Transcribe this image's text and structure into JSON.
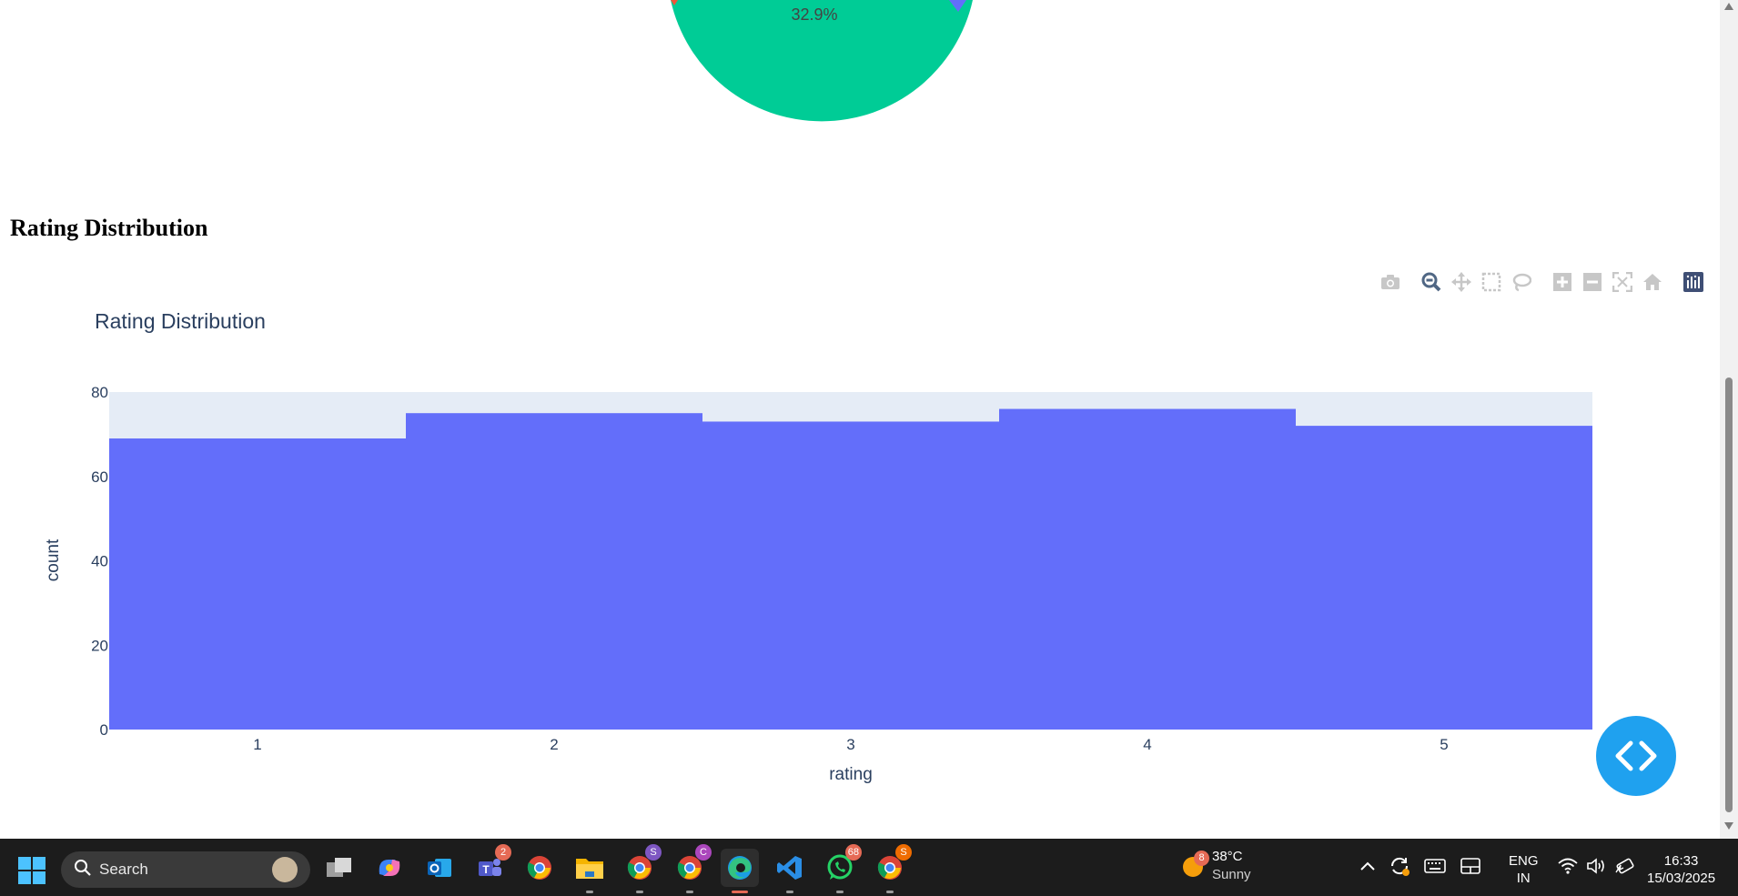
{
  "section_heading": "Rating Distribution",
  "pie_chart": {
    "visible_label": "32.9%",
    "colors": {
      "main": "#00cc96",
      "left": "#ef553b",
      "right": "#636efa"
    }
  },
  "modebar": [
    {
      "name": "download-plot-icon",
      "title": "Download plot as a png"
    },
    {
      "name": "zoom-icon",
      "title": "Zoom"
    },
    {
      "name": "pan-icon",
      "title": "Pan"
    },
    {
      "name": "box-select-icon",
      "title": "Box Select"
    },
    {
      "name": "lasso-select-icon",
      "title": "Lasso Select"
    },
    {
      "name": "zoom-in-icon",
      "title": "Zoom in"
    },
    {
      "name": "zoom-out-icon",
      "title": "Zoom out"
    },
    {
      "name": "autoscale-icon",
      "title": "Autoscale"
    },
    {
      "name": "reset-axes-icon",
      "title": "Reset axes"
    },
    {
      "name": "plotly-logo-icon",
      "title": "Produced with Plotly"
    }
  ],
  "chart_data": {
    "type": "bar",
    "title": "Rating Distribution",
    "xlabel": "rating",
    "ylabel": "count",
    "categories": [
      "1",
      "2",
      "3",
      "4",
      "5"
    ],
    "values": [
      69,
      75,
      73,
      76,
      72
    ],
    "ylim": [
      0,
      80
    ],
    "yticks": [
      "0",
      "20",
      "40",
      "60",
      "80"
    ],
    "bar_color": "#636efa",
    "plot_bg": "#e5ecf6",
    "grid": false,
    "legend": "none"
  },
  "fab": {
    "icon": "code-brackets-icon"
  },
  "taskbar": {
    "search_label": "Search",
    "apps": [
      {
        "name": "task-view-icon",
        "badge": ""
      },
      {
        "name": "copilot-icon",
        "badge": ""
      },
      {
        "name": "outlook-icon",
        "badge": ""
      },
      {
        "name": "teams-icon",
        "badge": "2"
      },
      {
        "name": "chrome-icon",
        "badge": ""
      },
      {
        "name": "file-explorer-icon",
        "badge": ""
      },
      {
        "name": "chrome-profile-s-icon",
        "badge": "S"
      },
      {
        "name": "chrome-profile-c-icon",
        "badge": "C"
      },
      {
        "name": "edge-icon",
        "badge": ""
      },
      {
        "name": "vscode-icon",
        "badge": ""
      },
      {
        "name": "whatsapp-icon",
        "badge": "68"
      },
      {
        "name": "chrome-profile-s2-icon",
        "badge": "S"
      }
    ],
    "weather": {
      "badge": "8",
      "temp": "38°C",
      "condition": "Sunny"
    },
    "lang_1": "ENG",
    "lang_2": "IN",
    "time": "16:33",
    "date": "15/03/2025"
  }
}
